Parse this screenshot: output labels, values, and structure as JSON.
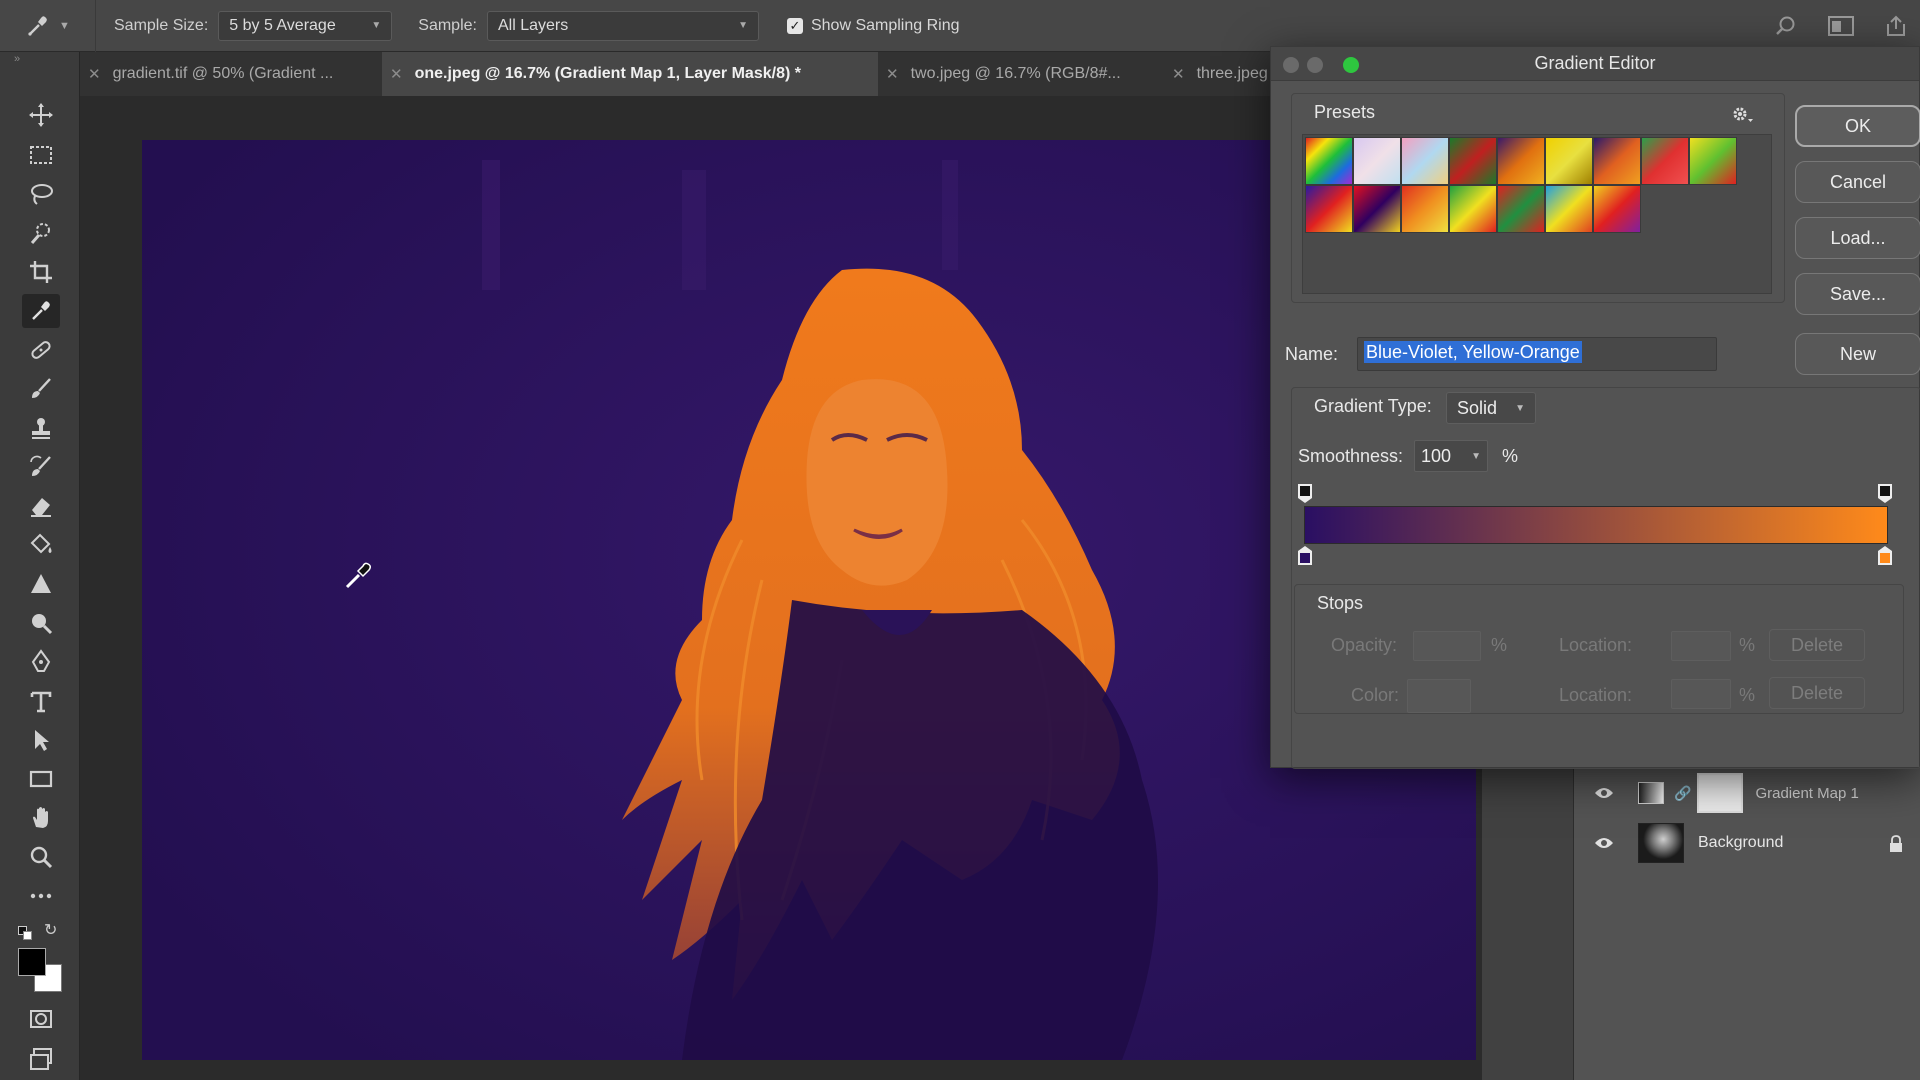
{
  "options_bar": {
    "sample_size_label": "Sample Size:",
    "sample_size_value": "5 by 5 Average",
    "sample_label": "Sample:",
    "sample_value": "All Layers",
    "show_sampling_ring_label": "Show Sampling Ring",
    "show_sampling_ring_checked": true
  },
  "tabs": [
    {
      "label": "gradient.tif @ 50% (Gradient ...",
      "active": false
    },
    {
      "label": "one.jpeg @ 16.7% (Gradient Map 1, Layer Mask/8) *",
      "active": true
    },
    {
      "label": "two.jpeg @ 16.7% (RGB/8#...",
      "active": false
    },
    {
      "label": "three.jpeg",
      "active": false
    }
  ],
  "layers": [
    {
      "name": "Gradient Map 1",
      "visible": true
    },
    {
      "name": "Background",
      "visible": true,
      "locked": true
    }
  ],
  "gradient_editor": {
    "title": "Gradient Editor",
    "presets_label": "Presets",
    "buttons": {
      "ok": "OK",
      "cancel": "Cancel",
      "load": "Load...",
      "save": "Save...",
      "new": "New"
    },
    "name_label": "Name:",
    "name_value": "Blue-Violet, Yellow-Orange",
    "gradient_type_label": "Gradient Type:",
    "gradient_type_value": "Solid",
    "smoothness_label": "Smoothness:",
    "smoothness_value": "100",
    "percent": "%",
    "stops_label": "Stops",
    "opacity_label": "Opacity:",
    "color_label": "Color:",
    "location_label": "Location:",
    "delete_label": "Delete",
    "gradient_colors": {
      "start": "#2a0f63",
      "end": "#ff8a1a"
    }
  },
  "colors": {
    "canvas_bg": "#2c145c",
    "hair_orange": "#f3801f",
    "ui_panel": "#535353"
  }
}
